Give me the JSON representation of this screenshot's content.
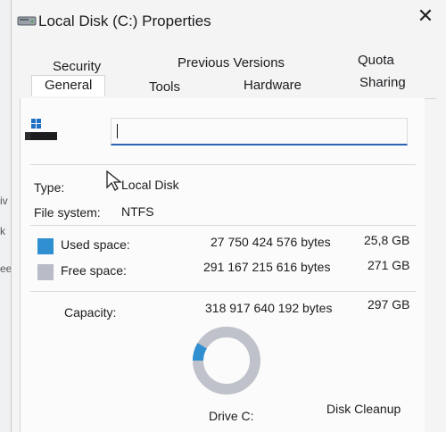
{
  "window": {
    "title": "Local Disk (C:) Properties",
    "close_glyph": "✕"
  },
  "background_fragments": [
    "iv",
    "k",
    "ee"
  ],
  "tabs": {
    "row1": [
      "Security",
      "Previous Versions",
      "Quota"
    ],
    "row2": [
      "General",
      "Tools",
      "Hardware",
      "Sharing"
    ],
    "active": "General"
  },
  "general": {
    "name_value": "",
    "type_label": "Type:",
    "type_value": "Local Disk",
    "fs_label": "File system:",
    "fs_value": "NTFS",
    "used": {
      "label": "Used space:",
      "bytes": "27 750 424 576 bytes",
      "size": "25,8 GB",
      "color": "#2f8fd0"
    },
    "free": {
      "label": "Free space:",
      "bytes": "291 167 215 616 bytes",
      "size": "271 GB",
      "color": "#b9bcc6"
    },
    "capacity": {
      "label": "Capacity:",
      "bytes": "318 917 640 192 bytes",
      "size": "297 GB"
    },
    "used_fraction": 0.087,
    "drive_label": "Drive C:",
    "cleanup_label": "Disk Cleanup"
  },
  "icons": [
    "drive-icon",
    "windows-logo-icon",
    "close-icon",
    "mouse-cursor-icon",
    "usage-donut"
  ]
}
